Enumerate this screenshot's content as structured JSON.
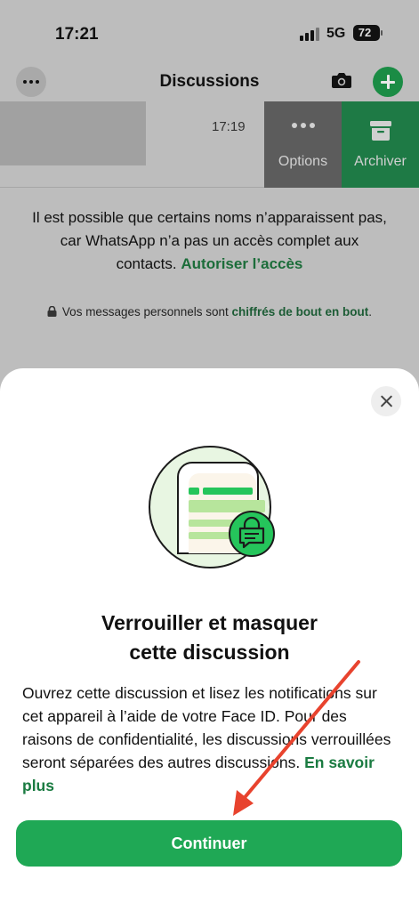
{
  "status_bar": {
    "time": "17:21",
    "network": "5G",
    "battery": "72"
  },
  "header": {
    "title": "Discussions"
  },
  "chat": {
    "time": "17:19",
    "options_label": "Options",
    "archive_label": "Archiver"
  },
  "info": {
    "line1": "Il est possible que certains noms n’apparaissent pas,",
    "line2": "car WhatsApp n’a pas un accès complet aux",
    "line3": "contacts.",
    "link": "Autoriser l’accès"
  },
  "encryption": {
    "text": "Vos messages personnels sont",
    "link": "chiffrés de bout en bout",
    "end": "."
  },
  "sheet": {
    "title_line1": "Verrouiller et masquer",
    "title_line2": "cette discussion",
    "body": "Ouvrez cette discussion et lisez les notifications sur cet appareil à l’aide de votre Face ID. Pour des raisons de confidentialité, les discussions verrouillées seront séparées des autres discussions.",
    "learn_more": "En savoir plus",
    "continue_label": "Continuer"
  },
  "colors": {
    "accent": "#1fa855",
    "archive": "#1e7a45",
    "arrow": "#e8432e"
  }
}
